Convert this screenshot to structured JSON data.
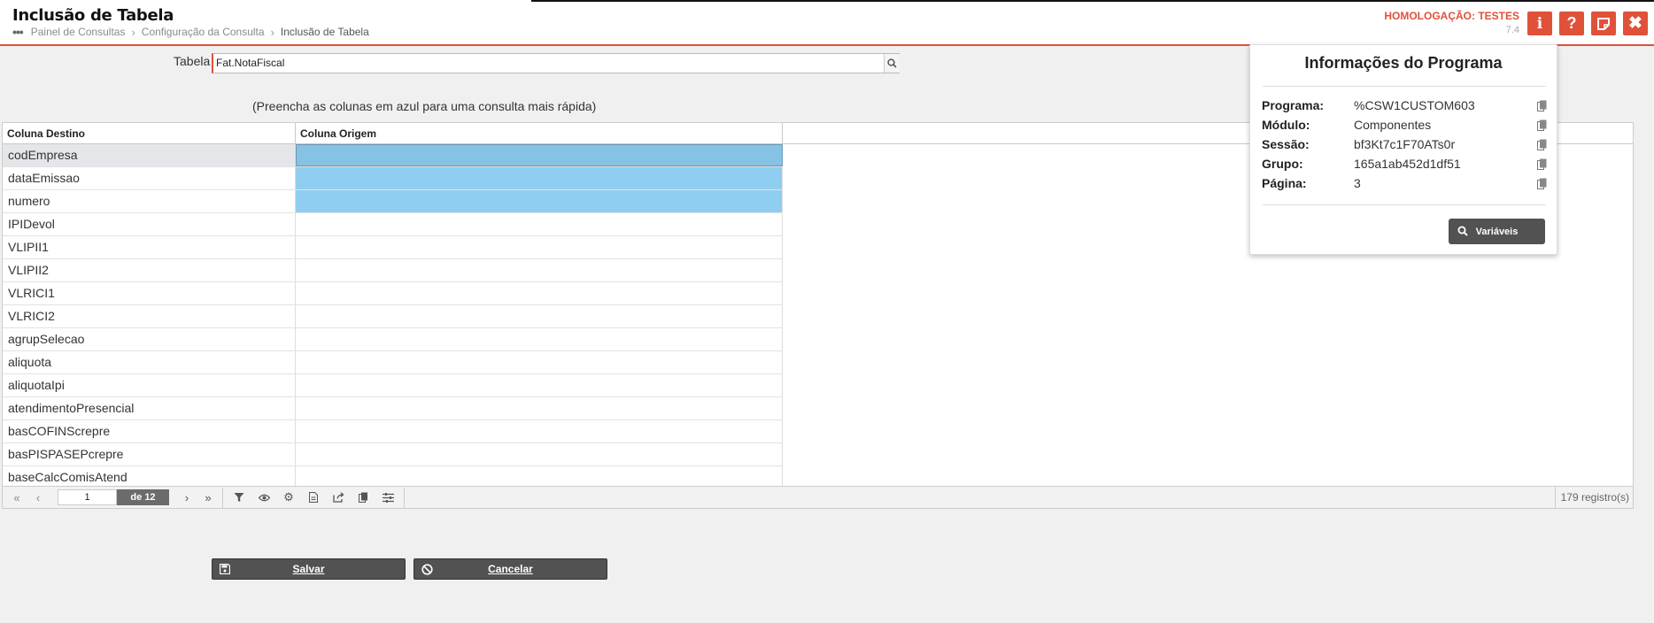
{
  "header": {
    "title": "Inclusão de Tabela",
    "breadcrumb": [
      "Painel de Consultas",
      "Configuração da Consulta",
      "Inclusão de Tabela"
    ],
    "environment": "HOMOLOGAÇÃO: TESTES",
    "version": "7.4",
    "accent_color": "#e0513a"
  },
  "form": {
    "tabela_label": "Tabela",
    "tabela_value": "Fat.NotaFiscal",
    "hint": "(Preencha as colunas em azul para uma consulta mais rápida)"
  },
  "grid": {
    "columns": [
      "Coluna Destino",
      "Coluna Origem"
    ],
    "rows": [
      {
        "destino": "codEmpresa",
        "origem": "",
        "highlight": "selected"
      },
      {
        "destino": "dataEmissao",
        "origem": "",
        "highlight": "blue"
      },
      {
        "destino": "numero",
        "origem": "",
        "highlight": "blue"
      },
      {
        "destino": "IPIDevol",
        "origem": "",
        "highlight": ""
      },
      {
        "destino": "VLIPII1",
        "origem": "",
        "highlight": ""
      },
      {
        "destino": "VLIPII2",
        "origem": "",
        "highlight": ""
      },
      {
        "destino": "VLRICI1",
        "origem": "",
        "highlight": ""
      },
      {
        "destino": "VLRICI2",
        "origem": "",
        "highlight": ""
      },
      {
        "destino": "agrupSelecao",
        "origem": "",
        "highlight": ""
      },
      {
        "destino": "aliquota",
        "origem": "",
        "highlight": ""
      },
      {
        "destino": "aliquotaIpi",
        "origem": "",
        "highlight": ""
      },
      {
        "destino": "atendimentoPresencial",
        "origem": "",
        "highlight": ""
      },
      {
        "destino": "basCOFINScrepre",
        "origem": "",
        "highlight": ""
      },
      {
        "destino": "basPISPASEPcrepre",
        "origem": "",
        "highlight": ""
      },
      {
        "destino": "baseCalcComisAtend",
        "origem": "",
        "highlight": ""
      }
    ],
    "highlight_color": "#8fcdf1"
  },
  "pager": {
    "current_page": "1",
    "of_label": "de 12",
    "records": "179 registro(s)"
  },
  "buttons": {
    "save": "Salvar",
    "cancel": "Cancelar"
  },
  "popup": {
    "title": "Informações do Programa",
    "items": [
      {
        "label": "Programa:",
        "value": "%CSW1CUSTOM603"
      },
      {
        "label": "Módulo:",
        "value": "Componentes"
      },
      {
        "label": "Sessão:",
        "value": "bf3Kt7c1F70ATs0r"
      },
      {
        "label": "Grupo:",
        "value": "165a1ab452d1df51"
      },
      {
        "label": "Página:",
        "value": "3"
      }
    ],
    "variables_button": "Variáveis"
  }
}
